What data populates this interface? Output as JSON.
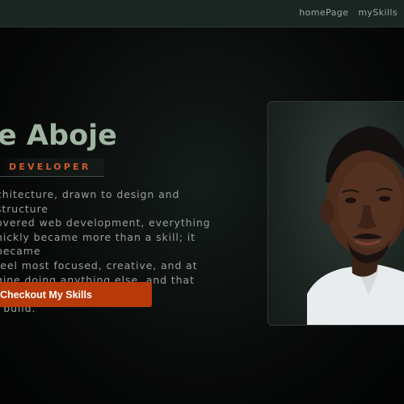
{
  "nav": {
    "links": [
      "homePage",
      "mySkills"
    ]
  },
  "hero": {
    "title": "e Aboje",
    "role": "DEVELOPER",
    "bio": "chitecture, drawn to design and structure\novered web development, everything\nnickly became more than a skill; it became\nfeel most focused, creative, and at\ngine doing anything else, and that passion\nl build.",
    "cta_label": "Checkout My Skills"
  },
  "colors": {
    "accent": "#b83a0a",
    "title": "#9fb5a2",
    "role": "#d0592a",
    "navbar": "#1b2622"
  }
}
